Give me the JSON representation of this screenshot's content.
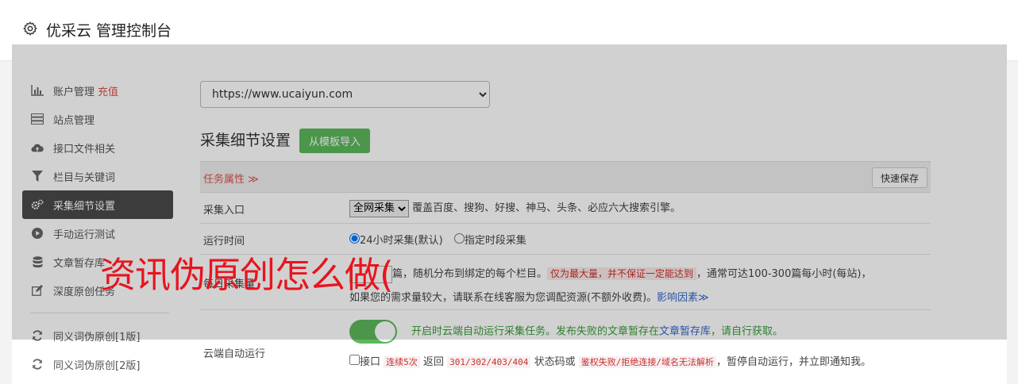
{
  "header": {
    "title": "优采云 管理控制台",
    "icon": "gear-icon"
  },
  "sidebar": {
    "items": [
      {
        "label": "账户管理",
        "tag": "充值",
        "icon": "bar-chart-icon"
      },
      {
        "label": "站点管理",
        "icon": "server-icon"
      },
      {
        "label": "接口文件相关",
        "icon": "cloud-upload-icon"
      },
      {
        "label": "栏目与关键词",
        "icon": "filter-icon"
      },
      {
        "label": "采集细节设置",
        "icon": "cogs-icon",
        "active": true
      },
      {
        "label": "手动运行测试",
        "icon": "play-icon"
      },
      {
        "label": "文章暂存库",
        "icon": "database-icon"
      },
      {
        "label": "深度原创任务",
        "icon": "edit-icon"
      },
      {
        "label": "同义词伪原创[1版]",
        "icon": "refresh-icon"
      },
      {
        "label": "同义词伪原创[2版]",
        "icon": "refresh-icon"
      }
    ]
  },
  "main": {
    "site_select": "https://www.ucaiyun.com",
    "section_title": "采集细节设置",
    "import_button": "从模板导入",
    "task_bar": {
      "label": "任务属性 ≫",
      "save_button": "快速保存"
    },
    "rows": {
      "entry": {
        "label": "采集入口",
        "select": "全网采集",
        "desc": "覆盖百度、搜狗、好搜、神马、头条、必应六大搜索引擎。"
      },
      "time": {
        "label": "运行时间",
        "option1": "24小时采集(默认)",
        "option2": "指定时段采集"
      },
      "volume": {
        "label": "每日采集量",
        "text1": "篇，随机分布到绑定的每个栏目。",
        "warn": "仅为最大量，并不保证一定能达到",
        "text2": "，通常可达100-300篇每小时(每站)，",
        "text3": "如果您的需求量较大，请联系在线客服为您调配资源(不额外收费)。",
        "link": "影响因素≫"
      },
      "cloud": {
        "label": "云端自动运行",
        "toggle_text_a": "开启时云端自动运行采集任务。",
        "toggle_text_b": "发布失败的文章暂存在",
        "toggle_link": "文章暂存库",
        "toggle_text_c": "，请自行获取。",
        "check_a": "接口",
        "check_code1": "连续5次",
        "check_b": "返回",
        "check_code2": "301/302/403/404",
        "check_c": "状态码或",
        "check_code3": "鉴权失败/拒绝连接/域名无法解析",
        "check_d": "，暂停自动运行，并立即通知我。"
      }
    }
  },
  "watermark": "资讯伪原创怎么做("
}
